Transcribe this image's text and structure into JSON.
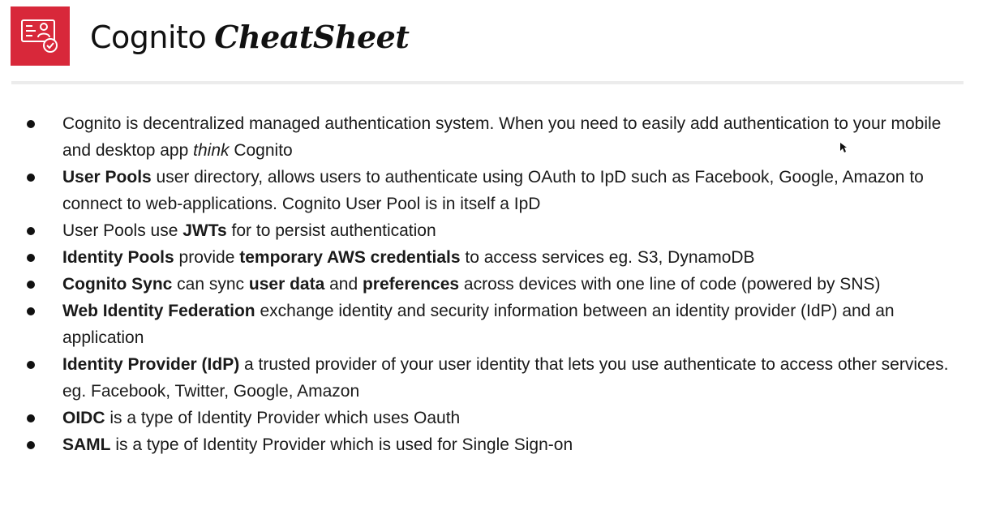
{
  "header": {
    "logo_icon": "cognito-user-identity-icon",
    "logo_color": "#d8283a",
    "title_plain": "Cognito",
    "title_script": "CheatSheet"
  },
  "bullets": [
    {
      "parts": [
        {
          "text": "Cognito is decentralized managed authentication system. When you need to easily add authentication to your mobile and desktop app ",
          "style": "normal"
        },
        {
          "text": "think",
          "style": "italic"
        },
        {
          "text": " Cognito",
          "style": "normal"
        }
      ]
    },
    {
      "parts": [
        {
          "text": "User Pools",
          "style": "bold"
        },
        {
          "text": " user directory, allows users to authenticate using OAuth to IpD such as Facebook, Google, Amazon to connect to web-applications. Cognito User Pool is in itself a IpD",
          "style": "normal"
        }
      ]
    },
    {
      "parts": [
        {
          "text": "User Pools use ",
          "style": "normal"
        },
        {
          "text": "JWTs",
          "style": "bold"
        },
        {
          "text": " for to persist authentication",
          "style": "normal"
        }
      ]
    },
    {
      "parts": [
        {
          "text": "Identity Pools",
          "style": "bold"
        },
        {
          "text": " provide ",
          "style": "normal"
        },
        {
          "text": "temporary AWS credentials",
          "style": "bold"
        },
        {
          "text": " to access services eg. S3, DynamoDB",
          "style": "normal"
        }
      ]
    },
    {
      "parts": [
        {
          "text": "Cognito Sync",
          "style": "bold"
        },
        {
          "text": " can sync ",
          "style": "normal"
        },
        {
          "text": "user data",
          "style": "bold"
        },
        {
          "text": " and ",
          "style": "normal"
        },
        {
          "text": "preferences",
          "style": "bold"
        },
        {
          "text": " across devices with one line of code (powered by SNS)",
          "style": "normal"
        }
      ]
    },
    {
      "parts": [
        {
          "text": "Web Identity Federation",
          "style": "bold"
        },
        {
          "text": " exchange identity and security information between an identity provider (IdP) and an application",
          "style": "normal"
        }
      ]
    },
    {
      "parts": [
        {
          "text": "Identity Provider (IdP)",
          "style": "bold"
        },
        {
          "text": " a trusted provider of your user identity that lets you use authenticate to access other services. eg. Facebook, Twitter, Google, Amazon",
          "style": "normal"
        }
      ]
    },
    {
      "parts": [
        {
          "text": "OIDC",
          "style": "bold"
        },
        {
          "text": " is a type of Identity Provider which uses Oauth",
          "style": "normal"
        }
      ]
    },
    {
      "parts": [
        {
          "text": "SAML",
          "style": "bold"
        },
        {
          "text": " is a type of Identity Provider which is used for Single Sign-on",
          "style": "normal"
        }
      ]
    }
  ]
}
